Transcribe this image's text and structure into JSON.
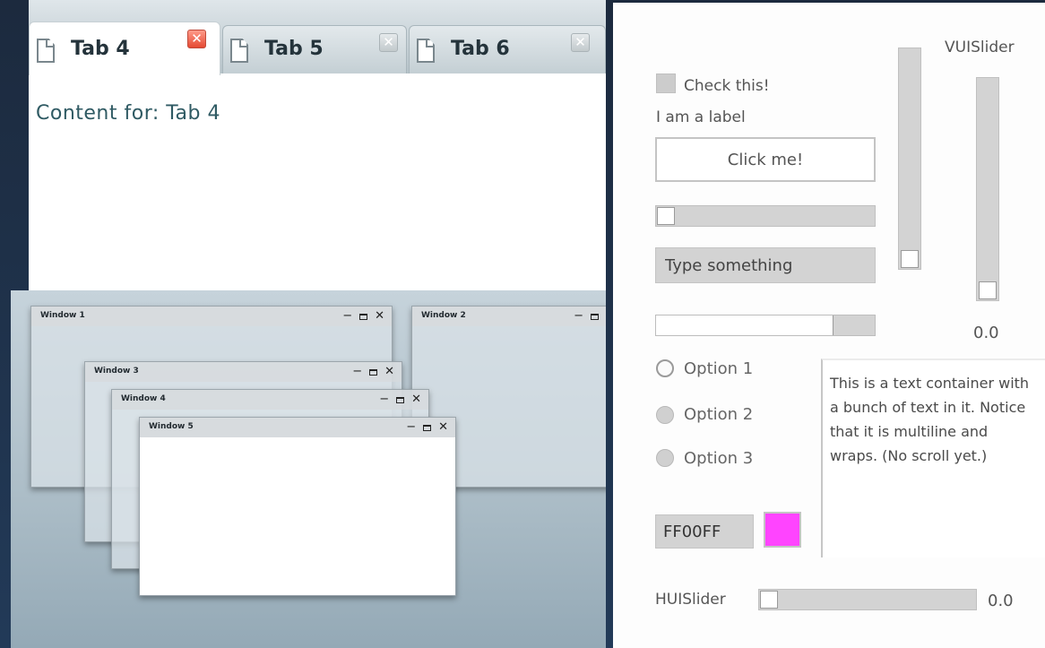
{
  "tabs": {
    "items": [
      {
        "label": "Tab 4",
        "active": true,
        "close_icon": "close-red-icon"
      },
      {
        "label": "Tab 5",
        "active": false,
        "close_icon": "close-grey-icon"
      },
      {
        "label": "Tab 6",
        "active": false,
        "close_icon": "close-grey-icon"
      }
    ],
    "content": "Content for: Tab 4"
  },
  "windows": {
    "items": [
      {
        "title": "Window 1"
      },
      {
        "title": "Window 2"
      },
      {
        "title": "Window 3"
      },
      {
        "title": "Window 4"
      },
      {
        "title": "Window 5"
      }
    ],
    "controls": {
      "minimize": "−",
      "close": "✕"
    }
  },
  "controls": {
    "checkbox_label": "Check this!",
    "checked": false,
    "label": "I am a label",
    "button_label": "Click me!",
    "h_slider_top_value": 0,
    "text_input_value": "Type something",
    "progress_fraction": 0.81,
    "radio_options": [
      "Option 1",
      "Option 2",
      "Option 3"
    ],
    "radio_selected": 0,
    "text_container": "This is a text container with a bunch of text in it. Notice that it is multiline and wraps. (No scroll yet.)",
    "color_hex": "FF00FF",
    "color_swatch": "#ff44ff",
    "vui_slider_label": "VUISlider",
    "vui_slider_value": "0.0",
    "v_slider_1_value": 0,
    "hui_slider_label": "HUISlider",
    "hui_slider_value": "0.0"
  },
  "colors": {
    "active_close": "#e54a33",
    "swatch": "#ff44ff",
    "tab_text": "#24333b",
    "content_text": "#2f5a63"
  }
}
